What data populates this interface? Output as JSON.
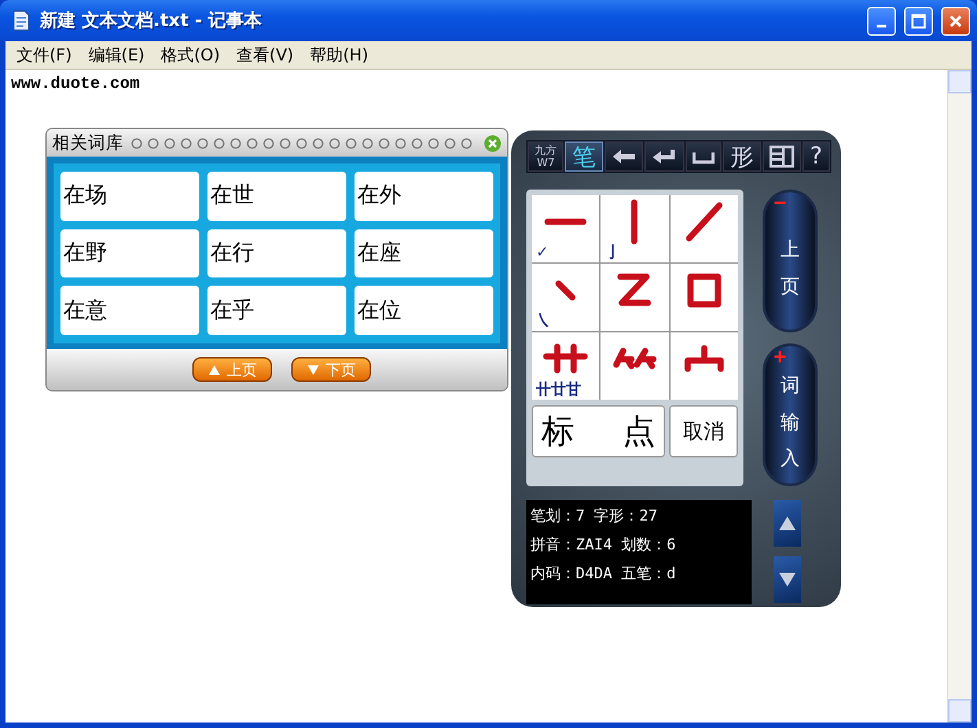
{
  "window": {
    "title": "新建 文本文档.txt - 记事本"
  },
  "menu": [
    {
      "label": "文件(F)"
    },
    {
      "label": "编辑(E)"
    },
    {
      "label": "格式(O)"
    },
    {
      "label": "查看(V)"
    },
    {
      "label": "帮助(H)"
    }
  ],
  "document": {
    "text": "www.duote.com"
  },
  "word_panel": {
    "title": "相关词库",
    "words": [
      "在场",
      "在世",
      "在外",
      "在野",
      "在行",
      "在座",
      "在意",
      "在乎",
      "在位"
    ],
    "buttons": [
      {
        "kind": "up",
        "label": "上页"
      },
      {
        "kind": "down",
        "label": "下页"
      }
    ]
  },
  "handwriting_panel": {
    "toolbar": [
      {
        "kind": "logo",
        "label": "九方",
        "sub": "W7",
        "selected": false
      },
      {
        "kind": "char",
        "label": "笔",
        "selected": true
      },
      {
        "kind": "backspace",
        "selected": false
      },
      {
        "kind": "enter",
        "selected": false
      },
      {
        "kind": "space",
        "selected": false
      },
      {
        "kind": "char",
        "label": "形",
        "selected": false
      },
      {
        "kind": "layout",
        "selected": false
      },
      {
        "kind": "char",
        "label": "?",
        "selected": false
      }
    ],
    "strokes": [
      {
        "kind": "horizontal",
        "mark": "✓"
      },
      {
        "kind": "vertical",
        "mark": "亅"
      },
      {
        "kind": "left_falling"
      },
      {
        "kind": "dot",
        "mark": "㇏"
      },
      {
        "kind": "turning"
      },
      {
        "kind": "box"
      },
      {
        "kind": "grass",
        "mark": "卄廿甘"
      },
      {
        "kind": "bamboo"
      },
      {
        "kind": "roof"
      }
    ],
    "punctuation": {
      "left": "标",
      "right": "点"
    },
    "cancel": {
      "label": "取消"
    },
    "side_buttons": [
      {
        "sign": "−",
        "label": "上页"
      },
      {
        "sign": "+",
        "label": "词输入"
      }
    ],
    "info": [
      "笔划：7 字形：27",
      "拼音：ZAI4 划数：6",
      "内码：D4DA 五笔：d"
    ]
  }
}
